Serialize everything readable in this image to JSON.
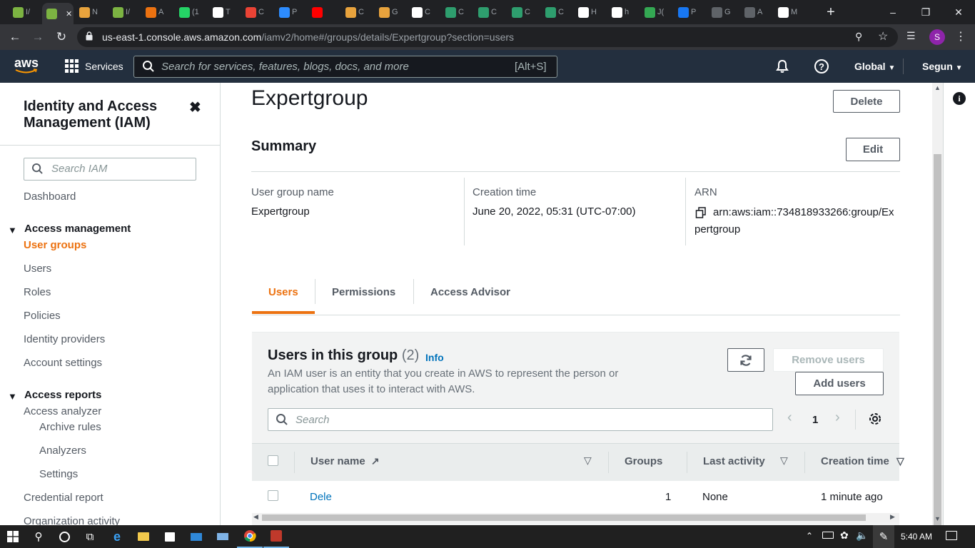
{
  "browser": {
    "tabs": [
      {
        "title": "I/"
      },
      {
        "title": ""
      },
      {
        "title": "N"
      },
      {
        "title": "I/"
      },
      {
        "title": "A"
      },
      {
        "title": "(1"
      },
      {
        "title": "T"
      },
      {
        "title": "C"
      },
      {
        "title": "P"
      },
      {
        "title": ""
      },
      {
        "title": "C"
      },
      {
        "title": "G"
      },
      {
        "title": "C"
      },
      {
        "title": "C"
      },
      {
        "title": "C"
      },
      {
        "title": "C"
      },
      {
        "title": "C"
      },
      {
        "title": "H"
      },
      {
        "title": "h"
      },
      {
        "title": "J("
      },
      {
        "title": "P"
      },
      {
        "title": "G"
      },
      {
        "title": "A"
      },
      {
        "title": "M"
      }
    ],
    "tab_colors": [
      "#7cb342",
      "#7cb342",
      "#e8a33d",
      "#7cb342",
      "#ec7211",
      "#25d366",
      "#ffffff",
      "#ea4335",
      "#2d8cff",
      "#ff0000",
      "#e8a33d",
      "#e8a33d",
      "#ffffff",
      "#2e9e6e",
      "#2e9e6e",
      "#2e9e6e",
      "#2e9e6e",
      "#ffffff",
      "#ffffff",
      "#34a853",
      "#1877f2",
      "#5f6368",
      "#5f6368",
      "#ffffff"
    ],
    "url_host": "us-east-1.console.aws.amazon.com",
    "url_path": "/iamv2/home#/groups/details/Expertgroup?section=users",
    "profile_initial": "S"
  },
  "aws_nav": {
    "logo": "aws",
    "services_label": "Services",
    "search_placeholder": "Search for services, features, blogs, docs, and more",
    "search_shortcut": "[Alt+S]",
    "region_label": "Global",
    "account_label": "Segun"
  },
  "sidebar": {
    "title": "Identity and Access Management (IAM)",
    "search_placeholder": "Search IAM",
    "dashboard": "Dashboard",
    "access_management": {
      "heading": "Access management",
      "items": [
        "User groups",
        "Users",
        "Roles",
        "Policies",
        "Identity providers",
        "Account settings"
      ]
    },
    "access_reports": {
      "heading": "Access reports",
      "analyzer": "Access analyzer",
      "sub_items": [
        "Archive rules",
        "Analyzers",
        "Settings"
      ],
      "items": [
        "Credential report",
        "Organization activity"
      ]
    }
  },
  "main": {
    "title": "Expertgroup",
    "delete_label": "Delete",
    "summary_heading": "Summary",
    "edit_label": "Edit",
    "summary": {
      "group_name_label": "User group name",
      "group_name_value": "Expertgroup",
      "creation_label": "Creation time",
      "creation_value": "June 20, 2022, 05:31 (UTC-07:00)",
      "arn_label": "ARN",
      "arn_line1": "arn:aws:iam::734818933266:group/Ex",
      "arn_line2": "pertgroup"
    },
    "tabs": [
      "Users",
      "Permissions",
      "Access Advisor"
    ],
    "users_panel": {
      "heading": "Users in this group",
      "count": "(2)",
      "info_link": "Info",
      "desc_line1": "An IAM user is an entity that you create in AWS to represent the person or",
      "desc_line2": "application that uses it to interact with AWS.",
      "remove_label": "Remove users",
      "add_label": "Add users",
      "search_placeholder": "Search",
      "page_number": "1",
      "columns": [
        "User name",
        "Groups",
        "Last activity",
        "Creation time"
      ],
      "rows": [
        {
          "name": "Dele",
          "groups": "1",
          "last_activity": "None",
          "created": "1 minute ago"
        }
      ]
    }
  },
  "taskbar": {
    "time": "5:40 AM"
  },
  "accent_color": "#ec7211",
  "link_color": "#0073bb"
}
